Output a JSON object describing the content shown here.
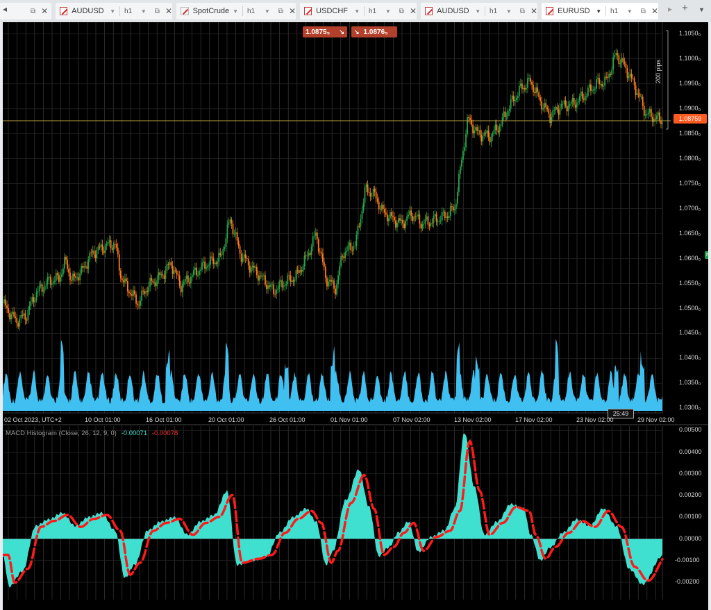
{
  "tabs": [
    {
      "symbol": "",
      "timeframe": "",
      "x": 0,
      "w": 74,
      "active": false,
      "partial": true
    },
    {
      "symbol": "AUDUSD",
      "timeframe": "h1",
      "active": false
    },
    {
      "symbol": "SpotCrude",
      "timeframe": "h1",
      "active": false
    },
    {
      "symbol": "USDCHF",
      "timeframe": "h1",
      "active": false
    },
    {
      "symbol": "AUDUSD",
      "timeframe": "h1",
      "active": false
    },
    {
      "symbol": "EURUSD",
      "timeframe": "h1",
      "active": true
    }
  ],
  "icons": {
    "popout": "external-link-icon",
    "close": "close-icon",
    "caret": "chevron-down-icon",
    "scroll_left": "chevron-left-icon",
    "scroll_right": "chevron-right-icon",
    "add": "plus-icon",
    "menu": "chevron-down-icon"
  },
  "quote": {
    "bid": "1.0875₅",
    "ask": "1.0876₅",
    "current_price": "1.08759",
    "pips_label": "200 pips",
    "countdown": "25:49",
    "green_marker": "N"
  },
  "price_axis": [
    "1.1050₀",
    "1.1000₀",
    "1.0950₀",
    "1.0900₀",
    "1.0850₀",
    "1.0800₀",
    "1.0750₀",
    "1.0700₀",
    "1.0650₀",
    "1.0600₀",
    "1.0550₀",
    "1.0500₀",
    "1.0450₀",
    "1.0400₀",
    "1.0350₀",
    "1.0300₀"
  ],
  "time_axis": [
    "02 Oct 2023, UTC+2",
    "10 Oct 01:00",
    "16 Oct 01:00",
    "20 Oct 01:00",
    "26 Oct 01:00",
    "01 Nov 01:00",
    "07 Nov 02:00",
    "13 Nov 02:00",
    "17 Nov 02:00",
    "23 Nov 02:00",
    "29 Nov 02:00"
  ],
  "macd": {
    "title": "MACD Histogram (Close, 26, 12, 9, 0)",
    "value1": "-0.00071",
    "value2": "-0.00078",
    "axis": [
      "0.00500",
      "0.00400",
      "0.00300",
      "0.00200",
      "0.00100",
      "0.00000",
      "-0.00100",
      "-0.00200"
    ]
  },
  "colors": {
    "background": "#000000",
    "bull_candle": "#26a64a",
    "bear_candle": "#ff7a1a",
    "volume": "#3fc0f0",
    "histogram": "#40e0d0",
    "signal": "#ff1a1a",
    "price_line": "#b8a040",
    "price_tag": "#ff5a1f",
    "badge": "#b2402a"
  },
  "chart_data": {
    "type": "candlestick",
    "symbol": "EURUSD",
    "timeframe": "h1",
    "ylim": [
      1.0295,
      1.1065
    ],
    "current_price": 1.08759,
    "price_path": [
      [
        0,
        1.051
      ],
      [
        0.02,
        1.0475
      ],
      [
        0.035,
        1.0485
      ],
      [
        0.05,
        1.053
      ],
      [
        0.07,
        1.0555
      ],
      [
        0.085,
        1.056
      ],
      [
        0.095,
        1.0595
      ],
      [
        0.105,
        1.0555
      ],
      [
        0.12,
        1.0575
      ],
      [
        0.135,
        1.061
      ],
      [
        0.155,
        1.0625
      ],
      [
        0.17,
        1.063
      ],
      [
        0.18,
        1.056
      ],
      [
        0.205,
        1.051
      ],
      [
        0.22,
        1.0545
      ],
      [
        0.24,
        1.0565
      ],
      [
        0.255,
        1.059
      ],
      [
        0.27,
        1.0545
      ],
      [
        0.29,
        1.057
      ],
      [
        0.31,
        1.059
      ],
      [
        0.33,
        1.06
      ],
      [
        0.345,
        1.068
      ],
      [
        0.36,
        1.061
      ],
      [
        0.375,
        1.0585
      ],
      [
        0.39,
        1.0565
      ],
      [
        0.41,
        1.0535
      ],
      [
        0.425,
        1.055
      ],
      [
        0.445,
        1.0565
      ],
      [
        0.46,
        1.06
      ],
      [
        0.475,
        1.065
      ],
      [
        0.49,
        1.056
      ],
      [
        0.505,
        1.054
      ],
      [
        0.515,
        1.061
      ],
      [
        0.535,
        1.063
      ],
      [
        0.55,
        1.074
      ],
      [
        0.565,
        1.0725
      ],
      [
        0.575,
        1.0695
      ],
      [
        0.59,
        1.068
      ],
      [
        0.605,
        1.067
      ],
      [
        0.62,
        1.069
      ],
      [
        0.635,
        1.067
      ],
      [
        0.65,
        1.0675
      ],
      [
        0.67,
        1.0685
      ],
      [
        0.685,
        1.07
      ],
      [
        0.705,
        1.088
      ],
      [
        0.72,
        1.085
      ],
      [
        0.74,
        1.0845
      ],
      [
        0.755,
        1.087
      ],
      [
        0.77,
        1.091
      ],
      [
        0.785,
        1.094
      ],
      [
        0.8,
        1.0955
      ],
      [
        0.815,
        1.0915
      ],
      [
        0.83,
        1.0885
      ],
      [
        0.845,
        1.0905
      ],
      [
        0.865,
        1.091
      ],
      [
        0.88,
        1.0925
      ],
      [
        0.9,
        1.095
      ],
      [
        0.915,
        1.0955
      ],
      [
        0.93,
        1.101
      ],
      [
        0.945,
        1.098
      ],
      [
        0.96,
        1.094
      ],
      [
        0.975,
        1.089
      ],
      [
        1,
        1.0876
      ]
    ],
    "volume_spikes": [
      0.09,
      0.25,
      0.34,
      0.43,
      0.5,
      0.69,
      0.72,
      0.84,
      0.93,
      0.97
    ],
    "macd_histogram": [
      [
        0,
        -0.0008
      ],
      [
        0.01,
        -0.0022
      ],
      [
        0.03,
        -0.0015
      ],
      [
        0.05,
        0.0006
      ],
      [
        0.07,
        0.0009
      ],
      [
        0.09,
        0.0012
      ],
      [
        0.11,
        0.0006
      ],
      [
        0.13,
        0.001
      ],
      [
        0.15,
        0.0012
      ],
      [
        0.17,
        0.0004
      ],
      [
        0.185,
        -0.0018
      ],
      [
        0.2,
        -0.0012
      ],
      [
        0.22,
        0.0004
      ],
      [
        0.24,
        0.0008
      ],
      [
        0.26,
        0.001
      ],
      [
        0.28,
        0.0002
      ],
      [
        0.3,
        0.0008
      ],
      [
        0.32,
        0.0011
      ],
      [
        0.34,
        0.0022
      ],
      [
        0.355,
        -0.0012
      ],
      [
        0.38,
        -0.001
      ],
      [
        0.4,
        -0.0008
      ],
      [
        0.42,
        0.0003
      ],
      [
        0.44,
        0.001
      ],
      [
        0.46,
        0.0014
      ],
      [
        0.475,
        0.0008
      ],
      [
        0.49,
        -0.0012
      ],
      [
        0.5,
        -0.0006
      ],
      [
        0.52,
        0.0018
      ],
      [
        0.54,
        0.0032
      ],
      [
        0.555,
        0.0015
      ],
      [
        0.57,
        -0.0008
      ],
      [
        0.585,
        -0.0004
      ],
      [
        0.6,
        0.0003
      ],
      [
        0.615,
        0.0008
      ],
      [
        0.63,
        -0.0006
      ],
      [
        0.65,
        0.0001
      ],
      [
        0.67,
        0.0004
      ],
      [
        0.685,
        0.0014
      ],
      [
        0.7,
        0.0049
      ],
      [
        0.715,
        0.0024
      ],
      [
        0.73,
        0.0002
      ],
      [
        0.75,
        0.0008
      ],
      [
        0.77,
        0.0016
      ],
      [
        0.79,
        0.0014
      ],
      [
        0.8,
        0.0002
      ],
      [
        0.815,
        -0.001
      ],
      [
        0.83,
        -0.0004
      ],
      [
        0.85,
        0.0003
      ],
      [
        0.87,
        0.0009
      ],
      [
        0.89,
        0.0006
      ],
      [
        0.91,
        0.0014
      ],
      [
        0.93,
        0.0006
      ],
      [
        0.95,
        -0.0014
      ],
      [
        0.97,
        -0.0021
      ],
      [
        1,
        -0.0008
      ]
    ],
    "macd_ylim": [
      -0.0028,
      0.0052
    ]
  }
}
